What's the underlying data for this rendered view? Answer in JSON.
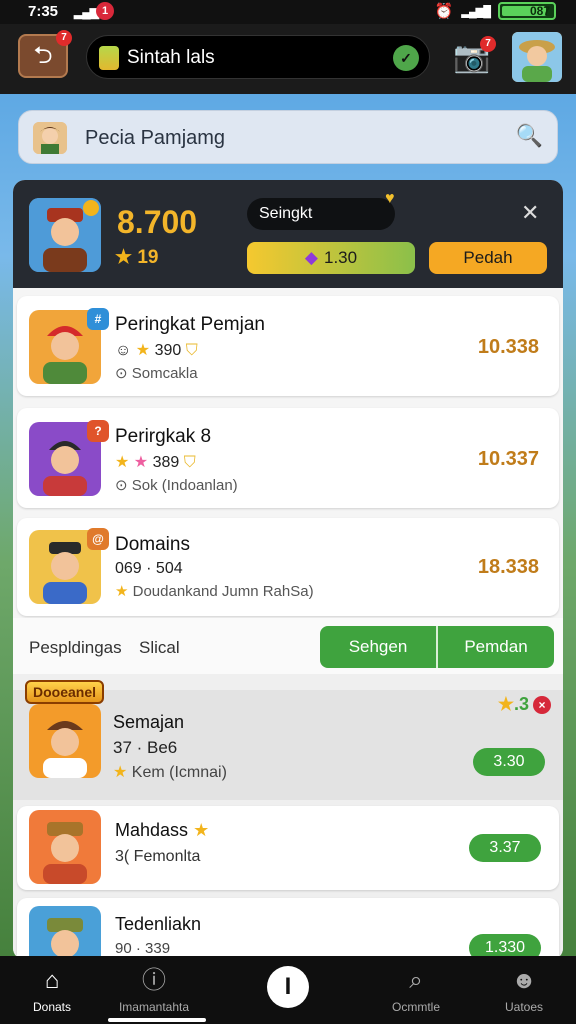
{
  "status_bar": {
    "time": "7:35",
    "notification_count": "1",
    "battery_text": "087",
    "battery_level_percent": 87
  },
  "app_bar": {
    "back_badge": "7",
    "title": "Sintah lals",
    "camera_badge": "7"
  },
  "search": {
    "placeholder": "Pecia Pamjamg"
  },
  "hero": {
    "score": "8.700",
    "stars": "19",
    "rank_tag": "Seingkt",
    "coin_value": "1.30",
    "action_label": "Pedah"
  },
  "players": [
    {
      "name": "Peringkat Pemjan",
      "stat": "390",
      "sub": "Somcakla",
      "value": "10.338"
    },
    {
      "name": "Perirgkak 8",
      "stat": "389",
      "sub": "Sok (Indoanlan)",
      "value": "10.337"
    },
    {
      "name": "Domains",
      "stat": "069 · 504",
      "sub": "Doudankand Jumn RahSa)",
      "value": "18.338"
    }
  ],
  "footer_row": {
    "label1": "Pespldingas",
    "label2": "Slical",
    "seg_left": "Sehgen",
    "seg_right": "Pemdan"
  },
  "list2": {
    "banner": "Dooeanel",
    "top_star_count": ".3",
    "items": [
      {
        "name": "Semajan",
        "line1": "37 · Be6",
        "line2": "Kem (Icmnai)",
        "button": "3.30"
      },
      {
        "name": "Mahdass",
        "line1": "3( Femonlta",
        "line2": "",
        "button": "3.37"
      },
      {
        "name": "Tedenliakn",
        "line1": "90 · 339",
        "line2": "",
        "button": "1.330"
      }
    ]
  },
  "bottom_nav": [
    {
      "label": "Donats",
      "icon": "home-icon"
    },
    {
      "label": "Imamantahta",
      "icon": "info-icon"
    },
    {
      "label": "",
      "icon": "center-action-icon",
      "glyph": "I"
    },
    {
      "label": "Ocmmtle",
      "icon": "search-icon"
    },
    {
      "label": "Uatoes",
      "icon": "user-icon"
    }
  ],
  "colors": {
    "gold": "#f3b52a",
    "green": "#3fa33e",
    "dark": "#262a31",
    "value_orange": "#c07c1a"
  }
}
